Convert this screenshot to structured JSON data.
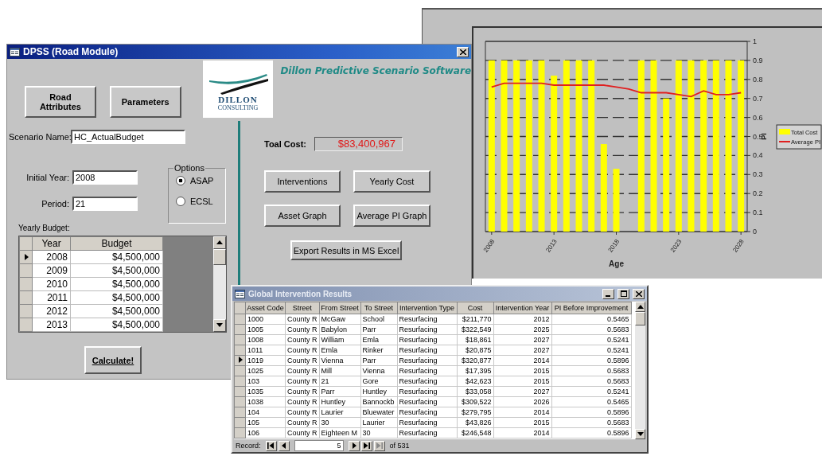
{
  "chart_window": {
    "chart_data": {
      "type": "bar",
      "xlabel": "Age",
      "ylabel": "PI",
      "x": [
        2008,
        2009,
        2010,
        2011,
        2012,
        2013,
        2014,
        2015,
        2016,
        2017,
        2018,
        2019,
        2020,
        2021,
        2022,
        2023,
        2024,
        2025,
        2026,
        2027,
        2028
      ],
      "series": [
        {
          "name": "Total Cost",
          "type": "bar",
          "color": "#ffff00",
          "values": [
            0.9,
            0.9,
            0.9,
            0.9,
            0.9,
            0.82,
            0.9,
            0.9,
            0.9,
            0.46,
            0.33,
            null,
            0.9,
            0.9,
            0.7,
            0.9,
            0.9,
            0.9,
            0.9,
            0.9,
            0.9
          ]
        },
        {
          "name": "Average PI",
          "type": "line",
          "color": "#e02020",
          "values": [
            0.76,
            0.78,
            0.78,
            0.78,
            0.78,
            0.77,
            0.77,
            0.77,
            0.77,
            0.77,
            0.76,
            0.75,
            0.73,
            0.73,
            0.73,
            0.72,
            0.71,
            0.74,
            0.72,
            0.72,
            0.73
          ]
        }
      ],
      "ylim": [
        0,
        1
      ],
      "yticks": [
        0,
        0.1,
        0.2,
        0.3,
        0.4,
        0.5,
        0.6,
        0.7,
        0.8,
        0.9,
        1
      ],
      "xlim": [
        2007.5,
        2028.5
      ],
      "xticks": [
        {
          "value": 2008,
          "label": "2008"
        },
        {
          "value": 2013,
          "label": "2013"
        },
        {
          "value": 2018,
          "label": "2018"
        },
        {
          "value": 2023,
          "label": "2023"
        },
        {
          "value": 2028,
          "label": "2028"
        }
      ],
      "grid": true,
      "legend": true
    }
  },
  "dpss_window": {
    "title": "DPSS (Road Module)",
    "logo": {
      "name": "DILLON",
      "subtitle": "CONSULTING"
    },
    "app_title": "Dillon Predictive Scenario Software",
    "top_buttons": [
      "Road Attributes",
      "Parameters"
    ],
    "fields": [
      {
        "label": "Scenario Name:",
        "value": "HC_ActualBudget"
      },
      {
        "label": "Initial Year:",
        "value": "2008"
      },
      {
        "label": "Period:",
        "value": "21"
      }
    ],
    "options": {
      "label": "Options",
      "items": [
        {
          "label": "ASAP",
          "selected": true
        },
        {
          "label": "ECSL",
          "selected": false
        }
      ]
    },
    "yearly_budget": {
      "label": "Yearly Budget:",
      "columns": [
        "Year",
        "Budget"
      ],
      "rows": [
        {
          "year": "2008",
          "budget": "$4,500,000",
          "selected": true
        },
        {
          "year": "2009",
          "budget": "$4,500,000",
          "selected": false
        },
        {
          "year": "2010",
          "budget": "$4,500,000",
          "selected": false
        },
        {
          "year": "2011",
          "budget": "$4,500,000",
          "selected": false
        },
        {
          "year": "2012",
          "budget": "$4,500,000",
          "selected": false
        },
        {
          "year": "2013",
          "budget": "$4,500,000",
          "selected": false
        }
      ]
    },
    "total_cost": {
      "label": "Toal Cost:",
      "value": "$83,400,967"
    },
    "result_buttons": [
      "Interventions",
      "Yearly Cost",
      "Asset Graph",
      "Average PI Graph"
    ],
    "export_button": "Export Results in MS Excel",
    "calculate_button": "Calculate!"
  },
  "results_window": {
    "title": "Global Intervention Results",
    "columns": [
      "Asset Code",
      "Street",
      "From Street",
      "To Street",
      "Intervention Type",
      "Cost",
      "Intervention Year",
      "PI Before Improvement"
    ],
    "rows": [
      {
        "cells": [
          "1000",
          "County R",
          "McGaw",
          "School",
          "Resurfacing",
          "$211,770",
          "2012",
          "0.5465"
        ],
        "selected": false
      },
      {
        "cells": [
          "1005",
          "County R",
          "Babylon",
          "Parr",
          "Resurfacing",
          "$322,549",
          "2025",
          "0.5683"
        ],
        "selected": false
      },
      {
        "cells": [
          "1008",
          "County R",
          "William",
          "Emla",
          "Resurfacing",
          "$18,861",
          "2027",
          "0.5241"
        ],
        "selected": false
      },
      {
        "cells": [
          "1011",
          "County R",
          "Emla",
          "Rinker",
          "Resurfacing",
          "$20,875",
          "2027",
          "0.5241"
        ],
        "selected": false
      },
      {
        "cells": [
          "1019",
          "County R",
          "Vienna",
          "Parr",
          "Resurfacing",
          "$320,877",
          "2014",
          "0.5896"
        ],
        "selected": true
      },
      {
        "cells": [
          "1025",
          "County R",
          "Mill",
          "Vienna",
          "Resurfacing",
          "$17,395",
          "2015",
          "0.5683"
        ],
        "selected": false
      },
      {
        "cells": [
          "103",
          "County R",
          "21",
          "Gore",
          "Resurfacing",
          "$42,623",
          "2015",
          "0.5683"
        ],
        "selected": false
      },
      {
        "cells": [
          "1035",
          "County R",
          "Parr",
          "Huntley",
          "Resurfacing",
          "$33,058",
          "2027",
          "0.5241"
        ],
        "selected": false
      },
      {
        "cells": [
          "1038",
          "County R",
          "Huntley",
          "Bannockb",
          "Resurfacing",
          "$309,522",
          "2026",
          "0.5465"
        ],
        "selected": false
      },
      {
        "cells": [
          "104",
          "County R",
          "Laurier",
          "Bluewater",
          "Resurfacing",
          "$279,795",
          "2014",
          "0.5896"
        ],
        "selected": false
      },
      {
        "cells": [
          "105",
          "County R",
          "30",
          "Laurier",
          "Resurfacing",
          "$43,826",
          "2015",
          "0.5683"
        ],
        "selected": false
      },
      {
        "cells": [
          "106",
          "County R",
          "Eighteen M",
          "30",
          "Resurfacing",
          "$246,548",
          "2014",
          "0.5896"
        ],
        "selected": false
      }
    ],
    "record_nav": {
      "label": "Record:",
      "current": "5",
      "of_label": "of 531"
    }
  }
}
